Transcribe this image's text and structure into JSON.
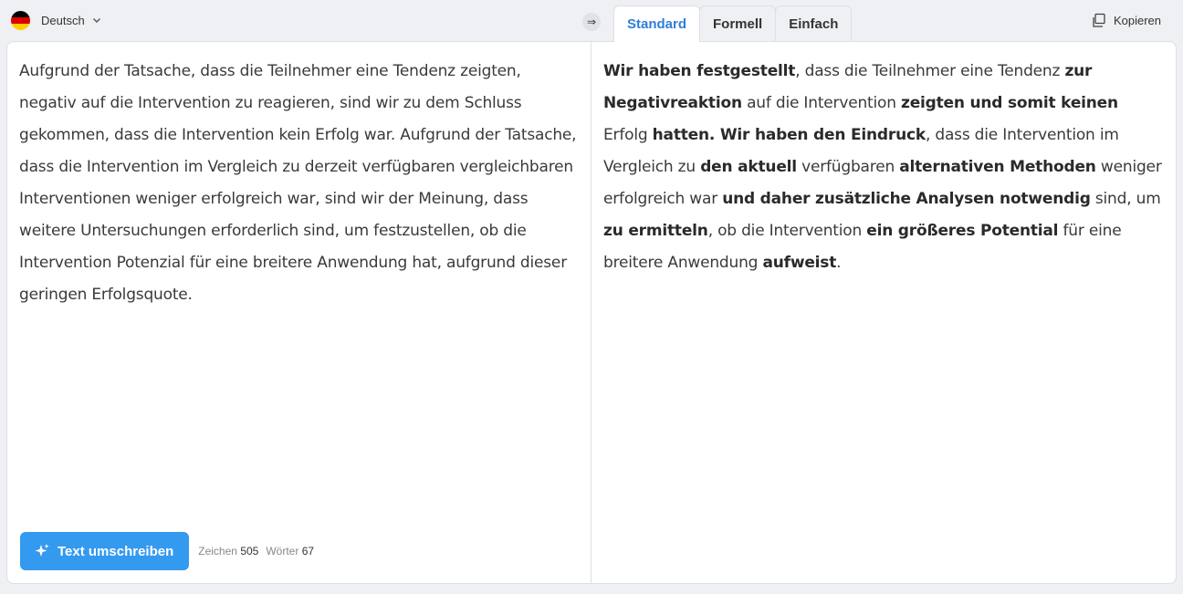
{
  "language": {
    "label": "Deutsch",
    "flag_colors": [
      "#000000",
      "#dd0000",
      "#ffce00"
    ]
  },
  "swap_icon": "⇒",
  "tabs": [
    {
      "label": "Standard",
      "active": true
    },
    {
      "label": "Formell",
      "active": false
    },
    {
      "label": "Einfach",
      "active": false
    }
  ],
  "copy": {
    "label": "Kopieren"
  },
  "input": {
    "text": "Aufgrund der Tatsache, dass die Teilnehmer eine Tendenz zeigten, negativ auf die Intervention zu reagieren, sind wir zu dem Schluss gekommen, dass die Intervention kein Erfolg war. Aufgrund der Tatsache, dass die Intervention im Vergleich zu derzeit verfügbaren vergleichbaren Interventionen weniger erfolgreich war, sind wir der Meinung, dass weitere Untersuchungen erforderlich sind, um festzustellen, ob die Intervention Potenzial für eine breitere Anwendung hat, aufgrund dieser geringen Erfolgsquote."
  },
  "output": {
    "segments": [
      {
        "text": "Wir haben festgestellt",
        "changed": true
      },
      {
        "text": ", dass die Teilnehmer eine Tendenz ",
        "changed": false
      },
      {
        "text": "zur Negativreaktion",
        "changed": true
      },
      {
        "text": " auf die Intervention ",
        "changed": false
      },
      {
        "text": "zeigten und somit keinen",
        "changed": true
      },
      {
        "text": " Erfolg ",
        "changed": false
      },
      {
        "text": "hatten. Wir haben den Eindruck",
        "changed": true
      },
      {
        "text": ", dass die Intervention im Vergleich zu ",
        "changed": false
      },
      {
        "text": "den aktuell",
        "changed": true
      },
      {
        "text": " verfügbaren ",
        "changed": false
      },
      {
        "text": "alternativen Methoden",
        "changed": true
      },
      {
        "text": " weniger erfolgreich war ",
        "changed": false
      },
      {
        "text": "und daher zusätzliche Analysen notwendig",
        "changed": true
      },
      {
        "text": " sind, um ",
        "changed": false
      },
      {
        "text": "zu ermitteln",
        "changed": true
      },
      {
        "text": ", ob die Intervention ",
        "changed": false
      },
      {
        "text": "ein größeres Potential",
        "changed": true
      },
      {
        "text": " für eine breitere Anwendung ",
        "changed": false
      },
      {
        "text": "aufweist",
        "changed": true
      },
      {
        "text": ".",
        "changed": false
      }
    ]
  },
  "rewrite_button": {
    "label": "Text umschreiben"
  },
  "stats": {
    "chars_label": "Zeichen",
    "chars": "505",
    "words_label": "Wörter",
    "words": "67"
  },
  "colors": {
    "accent": "#339af0",
    "active_tab": "#2f7ed8",
    "background": "#eff0f3"
  }
}
